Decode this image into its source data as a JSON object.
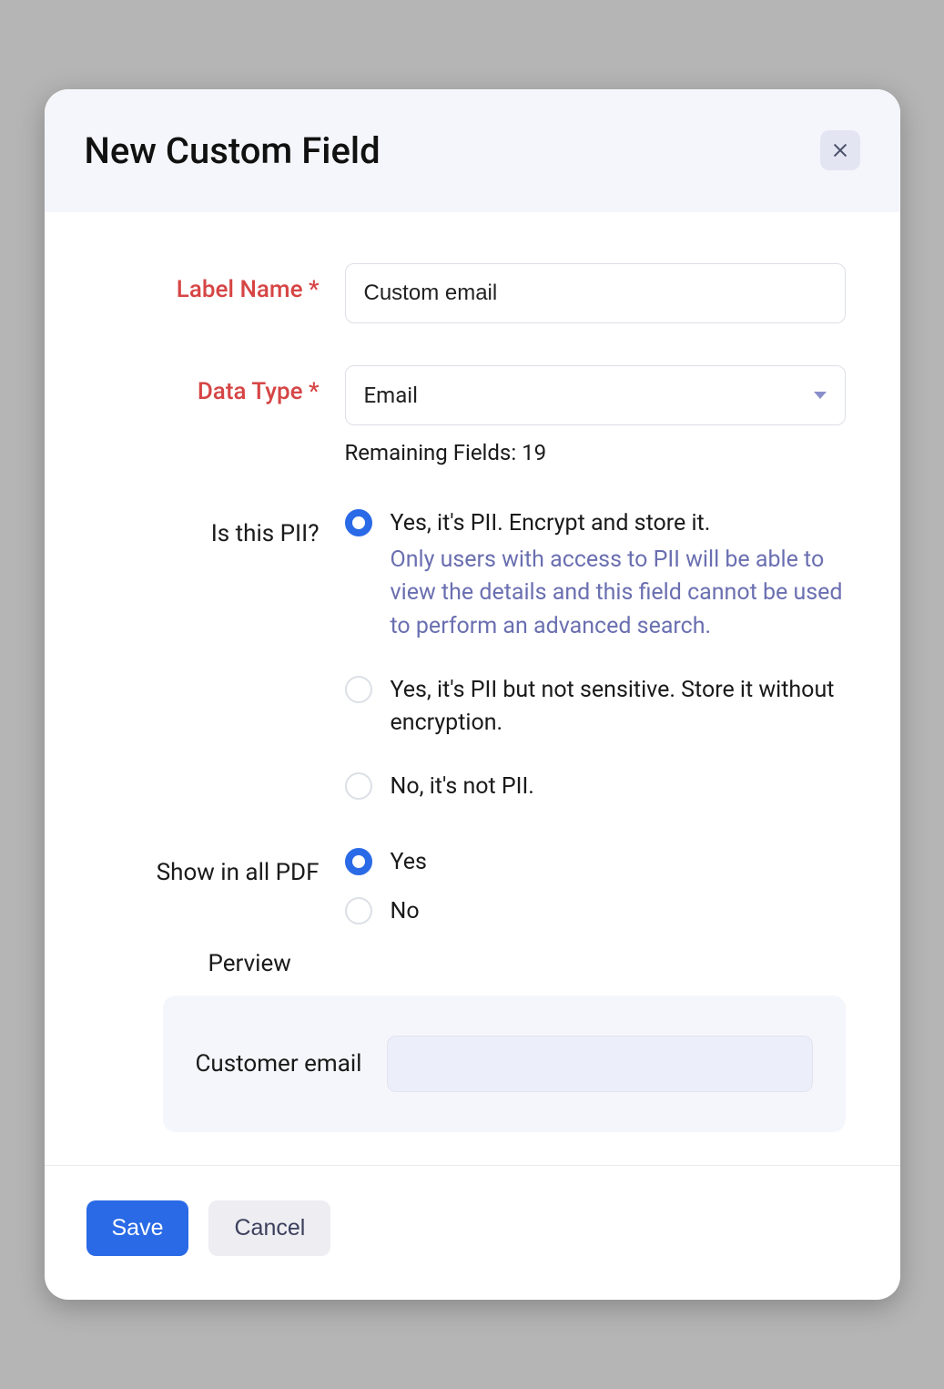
{
  "header": {
    "title": "New Custom Field"
  },
  "form": {
    "label_name": {
      "label": "Label Name *",
      "value": "Custom email"
    },
    "data_type": {
      "label": "Data Type *",
      "value": "Email",
      "remaining_text": "Remaining Fields: 19"
    },
    "pii": {
      "label": "Is this PII?",
      "options": [
        {
          "label": "Yes, it's PII. Encrypt and store it.",
          "sub": "Only users with access to PII will be able to view the details and this field cannot be used to perform an advanced search.",
          "selected": true
        },
        {
          "label": "Yes, it's PII but not sensitive. Store it without encryption.",
          "selected": false
        },
        {
          "label": "No, it's not PII.",
          "selected": false
        }
      ]
    },
    "show_pdf": {
      "label": "Show in all PDF",
      "options": [
        {
          "label": "Yes",
          "selected": true
        },
        {
          "label": "No",
          "selected": false
        }
      ]
    },
    "preview": {
      "heading": "Perview",
      "label": "Customer email"
    }
  },
  "footer": {
    "save": "Save",
    "cancel": "Cancel"
  }
}
